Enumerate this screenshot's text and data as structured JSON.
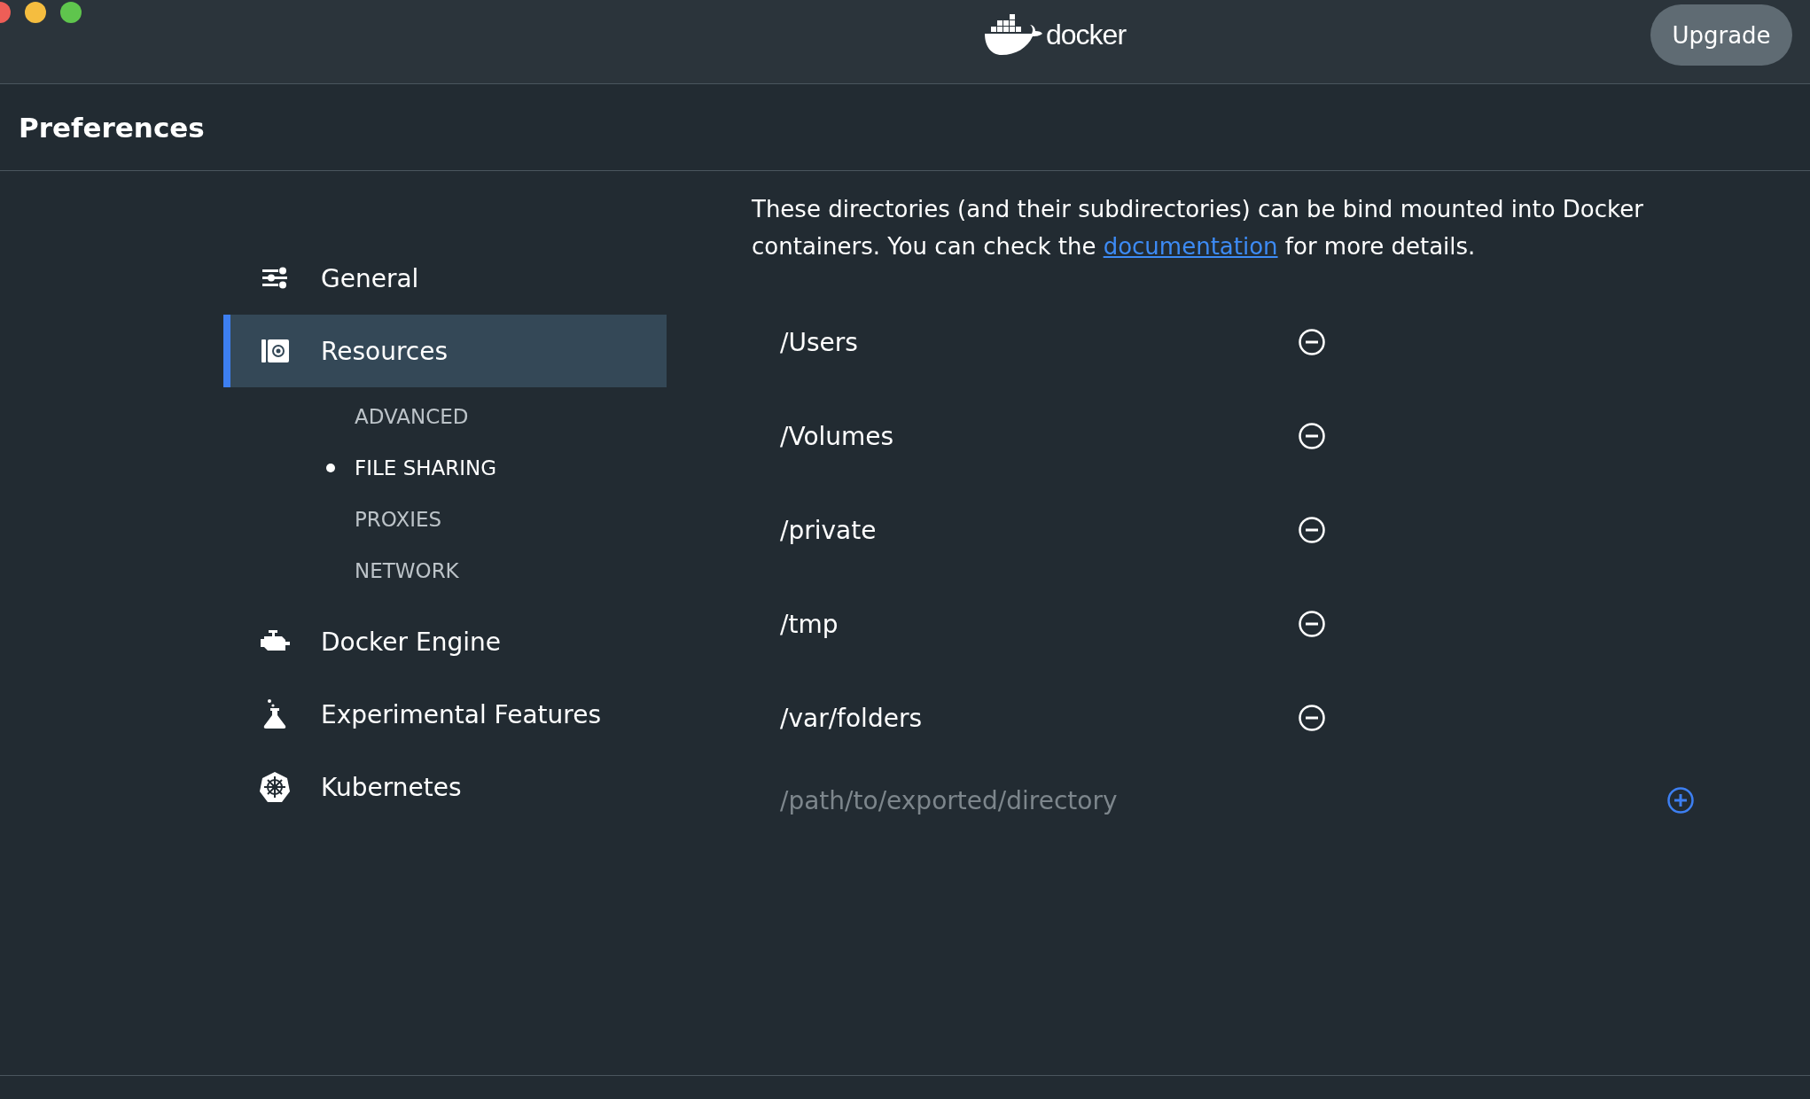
{
  "window": {
    "title_logo": "docker",
    "upgrade_button": "Upgrade"
  },
  "header": {
    "title": "Preferences"
  },
  "sidebar": {
    "items": [
      {
        "label": "General",
        "selected": false
      },
      {
        "label": "Resources",
        "selected": true,
        "children": [
          {
            "label": "ADVANCED",
            "selected": false
          },
          {
            "label": "FILE SHARING",
            "selected": true
          },
          {
            "label": "PROXIES",
            "selected": false
          },
          {
            "label": "NETWORK",
            "selected": false
          }
        ]
      },
      {
        "label": "Docker Engine",
        "selected": false
      },
      {
        "label": "Experimental Features",
        "selected": false
      },
      {
        "label": "Kubernetes",
        "selected": false
      }
    ]
  },
  "file_sharing": {
    "description_before": "These directories (and their subdirectories) can be bind mounted into Docker containers. You can check the ",
    "link": "documentation",
    "description_after": " for more details.",
    "directories": [
      {
        "path": "/Users"
      },
      {
        "path": "/Volumes"
      },
      {
        "path": "/private"
      },
      {
        "path": "/tmp"
      },
      {
        "path": "/var/folders"
      }
    ],
    "new_directory": {
      "placeholder": "/path/to/exported/directory"
    }
  }
}
